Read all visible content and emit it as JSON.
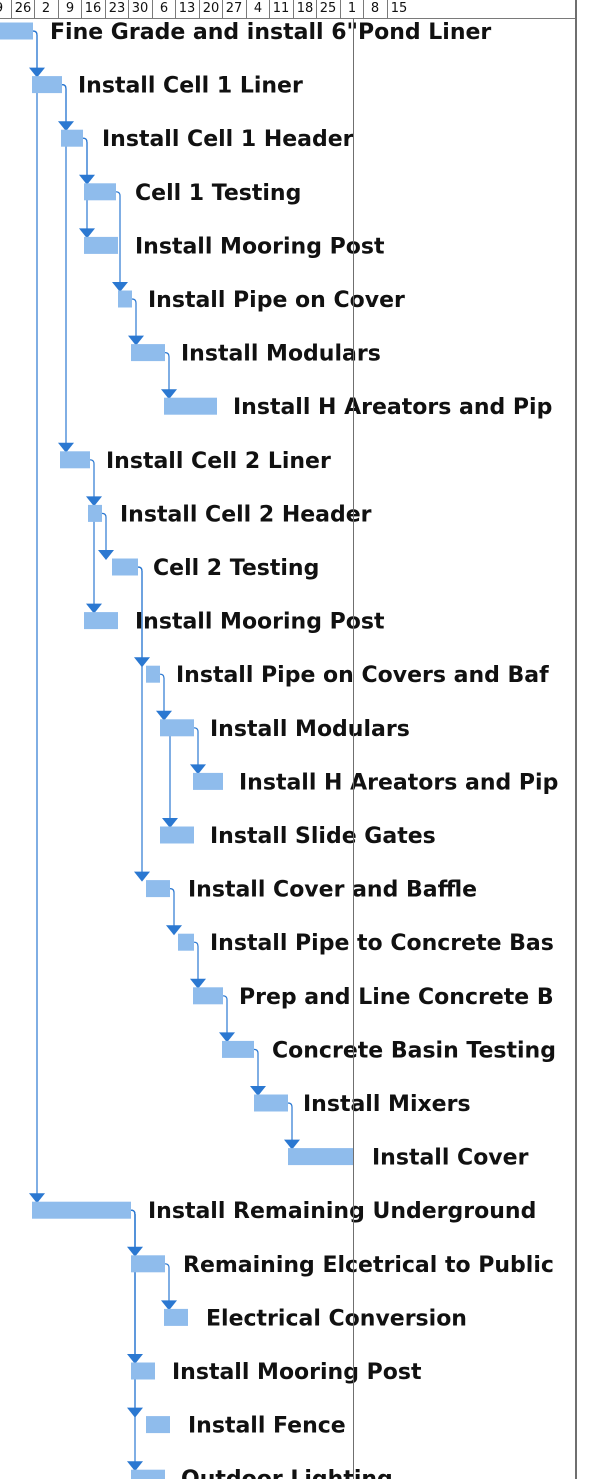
{
  "timeline": {
    "dates": [
      "9",
      "26",
      "2",
      "9",
      "16",
      "23",
      "30",
      "6",
      "13",
      "20",
      "27",
      "4",
      "11",
      "18",
      "25",
      "1",
      "8",
      "15"
    ]
  },
  "colors": {
    "bar": "#8fbcec",
    "connector": "#2b78d1",
    "grid": "#6f6f6f",
    "text": "#111111"
  },
  "tasks": [
    {
      "id": 1,
      "name": "Fine Grade and install 6\"Pond Liner"
    },
    {
      "id": 2,
      "name": "Install Cell 1 Liner"
    },
    {
      "id": 3,
      "name": "Install Cell 1 Header"
    },
    {
      "id": 4,
      "name": "Cell 1 Testing"
    },
    {
      "id": 5,
      "name": "Install Mooring Post"
    },
    {
      "id": 6,
      "name": "Install Pipe on Cover"
    },
    {
      "id": 7,
      "name": "Install Modulars"
    },
    {
      "id": 8,
      "name": "Install H Areators and Pip"
    },
    {
      "id": 9,
      "name": "Install Cell 2 Liner"
    },
    {
      "id": 10,
      "name": "Install Cell 2 Header"
    },
    {
      "id": 11,
      "name": "Cell 2 Testing"
    },
    {
      "id": 12,
      "name": "Install Mooring Post"
    },
    {
      "id": 13,
      "name": "Install Pipe on Covers and Baf"
    },
    {
      "id": 14,
      "name": "Install Modulars"
    },
    {
      "id": 15,
      "name": "Install H Areators and Pip"
    },
    {
      "id": 16,
      "name": "Install Slide Gates"
    },
    {
      "id": 17,
      "name": "Install Cover and Baffle"
    },
    {
      "id": 18,
      "name": "Install Pipe to Concrete Bas"
    },
    {
      "id": 19,
      "name": "Prep and Line Concrete B"
    },
    {
      "id": 20,
      "name": "Concrete Basin Testing"
    },
    {
      "id": 21,
      "name": "Install Mixers"
    },
    {
      "id": 22,
      "name": "Install Cover"
    },
    {
      "id": 23,
      "name": "Install Remaining Underground"
    },
    {
      "id": 24,
      "name": "Remaining Elcetrical to Public"
    },
    {
      "id": 25,
      "name": "Electrical Conversion"
    },
    {
      "id": 26,
      "name": "Install Mooring Post"
    },
    {
      "id": 27,
      "name": "Install Fence"
    },
    {
      "id": 28,
      "name": "Outdoor Lighting"
    }
  ],
  "links": [
    [
      1,
      2
    ],
    [
      2,
      3
    ],
    [
      3,
      4
    ],
    [
      4,
      6
    ],
    [
      6,
      7
    ],
    [
      7,
      8
    ],
    [
      2,
      9
    ],
    [
      3,
      5
    ],
    [
      9,
      10
    ],
    [
      10,
      11
    ],
    [
      10,
      12
    ],
    [
      11,
      13
    ],
    [
      13,
      14
    ],
    [
      14,
      15
    ],
    [
      14,
      16
    ],
    [
      11,
      17
    ],
    [
      17,
      18
    ],
    [
      18,
      19
    ],
    [
      19,
      20
    ],
    [
      20,
      21
    ],
    [
      21,
      22
    ],
    [
      1,
      23
    ],
    [
      23,
      24
    ],
    [
      24,
      25
    ],
    [
      23,
      26
    ],
    [
      23,
      27
    ],
    [
      23,
      28
    ]
  ]
}
